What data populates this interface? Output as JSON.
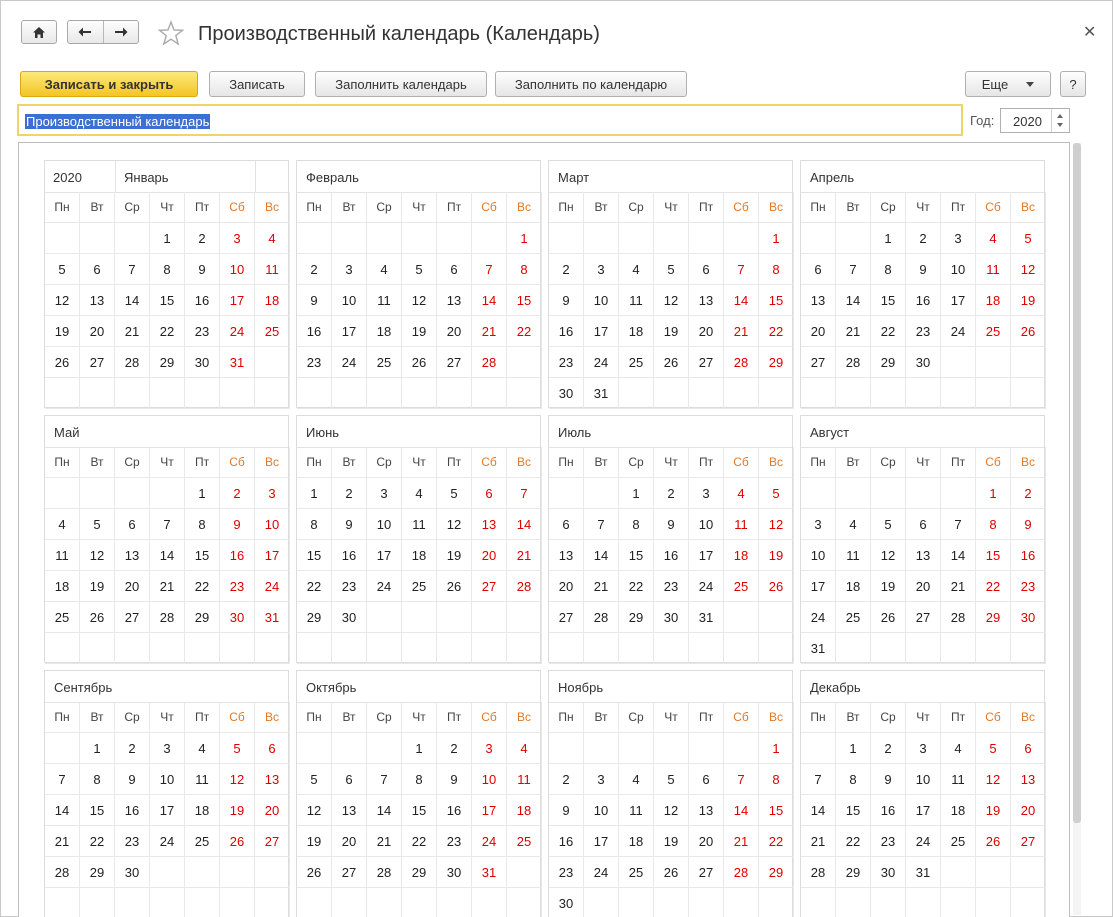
{
  "window": {
    "title": "Производственный календарь (Календарь)"
  },
  "toolbar": {
    "save_close": "Записать и закрыть",
    "save": "Записать",
    "fill_calendar": "Заполнить календарь",
    "fill_by_calendar": "Заполнить по календарю",
    "more": "Еще",
    "help": "?"
  },
  "form": {
    "name_value": "Производственный календарь",
    "year_label": "Год:",
    "year_value": "2020"
  },
  "calendar": {
    "year": "2020",
    "weekdays": [
      "Пн",
      "Вт",
      "Ср",
      "Чт",
      "Пт",
      "Сб",
      "Вс"
    ],
    "months": [
      {
        "name": "Январь",
        "offset": 3,
        "days": 31
      },
      {
        "name": "Февраль",
        "offset": 6,
        "days": 28
      },
      {
        "name": "Март",
        "offset": 6,
        "days": 31
      },
      {
        "name": "Апрель",
        "offset": 2,
        "days": 30
      },
      {
        "name": "Май",
        "offset": 4,
        "days": 31
      },
      {
        "name": "Июнь",
        "offset": 0,
        "days": 30
      },
      {
        "name": "Июль",
        "offset": 2,
        "days": 31
      },
      {
        "name": "Август",
        "offset": 5,
        "days": 31
      },
      {
        "name": "Сентябрь",
        "offset": 1,
        "days": 30
      },
      {
        "name": "Октябрь",
        "offset": 3,
        "days": 31
      },
      {
        "name": "Ноябрь",
        "offset": 6,
        "days": 30
      },
      {
        "name": "Декабрь",
        "offset": 1,
        "days": 31
      }
    ]
  },
  "colors": {
    "weekend": "#dd0000",
    "weekend_header": "#e07a2a",
    "primary_button": "#f3c525",
    "selection": "#3b6fd4"
  }
}
